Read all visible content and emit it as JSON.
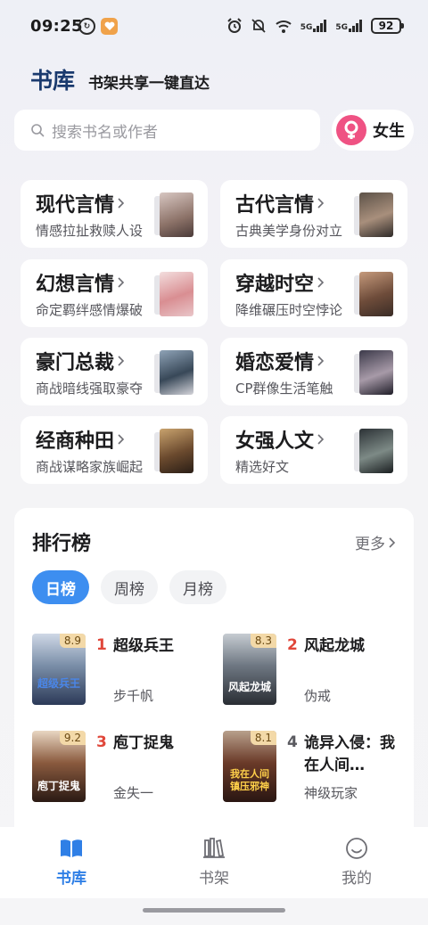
{
  "status_bar": {
    "time": "09:25",
    "battery": "92",
    "network": [
      "5G",
      "5G"
    ]
  },
  "header": {
    "title": "书库",
    "subtitle": "书架共享一键直达"
  },
  "search": {
    "placeholder": "搜索书名或作者"
  },
  "gender": {
    "label": "女生",
    "accent": "#ef5283"
  },
  "categories": [
    {
      "name": "现代言情",
      "desc": "情感拉扯救赎人设"
    },
    {
      "name": "古代言情",
      "desc": "古典美学身份对立"
    },
    {
      "name": "幻想言情",
      "desc": "命定羁绊感情爆破"
    },
    {
      "name": "穿越时空",
      "desc": "降维碾压时空悖论"
    },
    {
      "name": "豪门总裁",
      "desc": "商战暗线强取豪夺"
    },
    {
      "name": "婚恋爱情",
      "desc": "CP群像生活笔触"
    },
    {
      "name": "经商种田",
      "desc": "商战谋略家族崛起"
    },
    {
      "name": "女强人文",
      "desc": "精选好文"
    }
  ],
  "ranking": {
    "title": "排行榜",
    "more": "更多",
    "tabs": [
      "日榜",
      "周榜",
      "月榜"
    ],
    "active_tab": "日榜",
    "books": [
      {
        "rank": "1",
        "title": "超级兵王",
        "author": "步千帆",
        "score": "8.9",
        "cover_text": "超级兵王"
      },
      {
        "rank": "2",
        "title": "风起龙城",
        "author": "伪戒",
        "score": "8.3",
        "cover_text": "风起龙城"
      },
      {
        "rank": "3",
        "title": "庖丁捉鬼",
        "author": "金失一",
        "score": "9.2",
        "cover_text": "庖丁捉鬼"
      },
      {
        "rank": "4",
        "title": "诡异入侵：我在人间…",
        "author": "神级玩家",
        "score": "8.1",
        "cover_text": "我在人间镇压邪神"
      }
    ],
    "rank_colors": {
      "top3": "#e0473a",
      "other": "#5a5a60"
    }
  },
  "bottom_nav": [
    {
      "label": "书库",
      "icon": "book-open-icon",
      "active": true
    },
    {
      "label": "书架",
      "icon": "bookshelf-icon",
      "active": false
    },
    {
      "label": "我的",
      "icon": "smile-face-icon",
      "active": false
    }
  ],
  "colors": {
    "accent_blue": "#3d8ef0",
    "header_title": "#1a3a6e"
  }
}
